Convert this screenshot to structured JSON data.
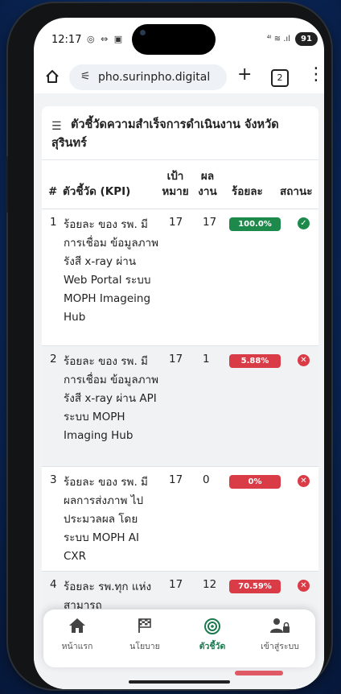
{
  "status_bar": {
    "time": "12:17",
    "left_icons": "◎ ⇔ ▣",
    "signal_icons": "⁴ᴵ ≋ .ıl",
    "battery": "91"
  },
  "browser": {
    "url": "pho.surinpho.digital",
    "tab_count": "2"
  },
  "page": {
    "title": "ตัวชี้วัดความสำเร็จการดำเนินงาน จังหวัดสุรินทร์",
    "table": {
      "headers": {
        "num": "#",
        "kpi": "ตัวชี้วัด (KPI)",
        "target": "เป้า หมาย",
        "result": "ผล งาน",
        "percent": "ร้อยละ",
        "status": "สถานะ"
      },
      "rows": [
        {
          "num": "1",
          "kpi": "ร้อยละ ของ รพ. มีการเชื่อม ข้อมูลภาพรังสี x-ray ผ่าน Web Portal ระบบ MOPH Imageing Hub",
          "target": "17",
          "result": "17",
          "percent": "100.0%",
          "status_icon": "✓",
          "status_color": "#1d8a4b"
        },
        {
          "num": "2",
          "kpi": "ร้อยละ ของ รพ. มีการเชื่อม ข้อมูลภาพรังสี x-ray ผ่าน API ระบบ MOPH Imaging Hub",
          "target": "17",
          "result": "1",
          "percent": "5.88%",
          "status_icon": "✕",
          "status_color": "#d93b47"
        },
        {
          "num": "3",
          "kpi": "ร้อยละ ของ รพ. มีผลการส่งภาพ ไปประมวลผล โดยระบบ MOPH AI CXR",
          "target": "17",
          "result": "0",
          "percent": "0%",
          "status_icon": "✕",
          "status_color": "#d93b47"
        },
        {
          "num": "4",
          "kpi": "ร้อยละ รพ.ทุก แห่ง สามารถ",
          "target": "17",
          "result": "12",
          "percent": "70.59%",
          "status_icon": "✕",
          "status_color": "#d93b47"
        }
      ]
    }
  },
  "bottom_nav": [
    {
      "label": "หน้าแรก",
      "icon": "home-icon",
      "active": false
    },
    {
      "label": "นโยบาย",
      "icon": "flag-icon",
      "active": false
    },
    {
      "label": "ตัวชี้วัด",
      "icon": "target-icon",
      "active": true
    },
    {
      "label": "เข้าสู่ระบบ",
      "icon": "user-lock-icon",
      "active": false
    }
  ]
}
